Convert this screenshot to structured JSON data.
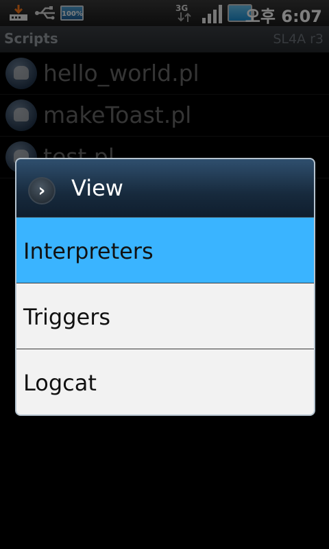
{
  "status_bar": {
    "icons": [
      "download-icon",
      "usb-icon",
      "battery-small-icon",
      "network-3g-icon",
      "signal-icon",
      "battery-icon"
    ],
    "battery_label": "100%",
    "network_label": "3G",
    "time": "오후 6:07"
  },
  "app": {
    "title": "Scripts",
    "version": "SL4A r3"
  },
  "scripts": [
    {
      "label": "hello_world.pl",
      "icon": "camel-icon"
    },
    {
      "label": "makeToast.pl",
      "icon": "camel-icon"
    },
    {
      "label": "test.pl",
      "icon": "camel-icon"
    }
  ],
  "dialog": {
    "title": "View",
    "icon": "chevron-right-icon",
    "items": [
      {
        "label": "Interpreters",
        "selected": true
      },
      {
        "label": "Triggers",
        "selected": false
      },
      {
        "label": "Logcat",
        "selected": false
      }
    ],
    "colors": {
      "selected": "#3ab4ff",
      "background": "#f2f2f2",
      "header": "#1c3249"
    }
  }
}
